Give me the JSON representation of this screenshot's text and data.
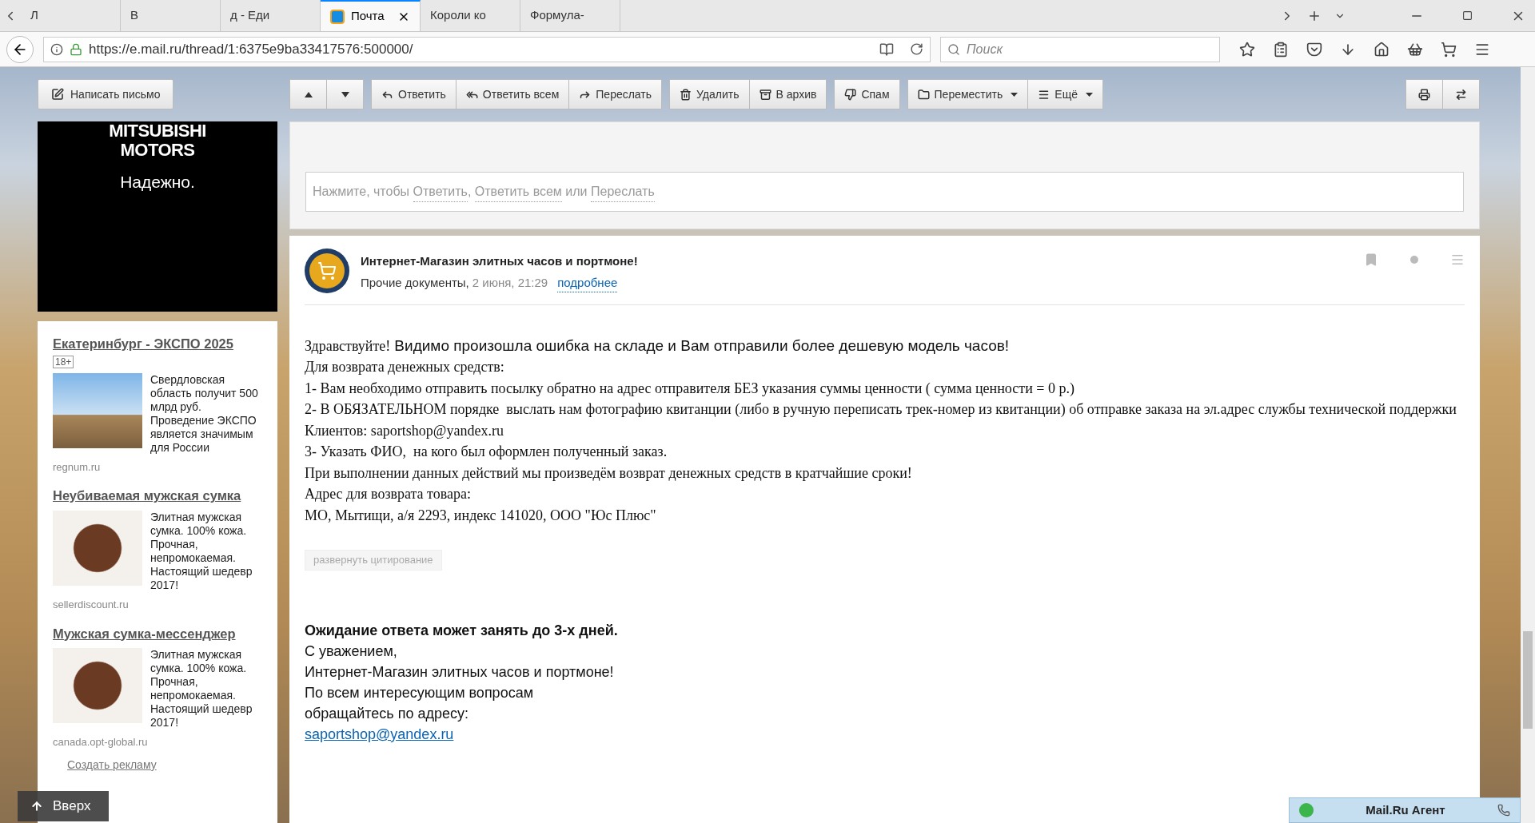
{
  "browser": {
    "tabs": [
      {
        "label": "Л",
        "selected": false
      },
      {
        "label": "В",
        "selected": false
      },
      {
        "label": "д - Еди",
        "selected": false
      },
      {
        "label": "Почта",
        "selected": true
      },
      {
        "label": "Короли ко",
        "selected": false
      },
      {
        "label": "Формула-",
        "selected": false
      }
    ],
    "url": "https://e.mail.ru/thread/1:6375e9ba33417576:500000/",
    "search": {
      "placeholder": "Поиск"
    }
  },
  "toolbar": {
    "compose": "Написать письмо",
    "groups": [
      [
        {
          "kind": "up"
        },
        {
          "kind": "down"
        }
      ],
      [
        {
          "kind": "reply",
          "label": "Ответить"
        },
        {
          "kind": "replyall",
          "label": "Ответить всем"
        },
        {
          "kind": "forward",
          "label": "Переслать"
        }
      ],
      [
        {
          "kind": "trash",
          "label": "Удалить"
        },
        {
          "kind": "archive",
          "label": "В архив"
        }
      ],
      [
        {
          "kind": "spam",
          "label": "Спам"
        }
      ],
      [
        {
          "kind": "folder",
          "label": "Переместить",
          "dropdown": true
        },
        {
          "kind": "lines",
          "label": "Ещё",
          "dropdown": true
        }
      ],
      [
        {
          "kind": "print"
        },
        {
          "kind": "convert"
        }
      ]
    ]
  },
  "banner": {
    "brand": "MITSUBISHI MOTORS",
    "slogan": "Надежно."
  },
  "ads": [
    {
      "title": "Екатеринбург - ЭКСПО 2025",
      "age": "18+",
      "text": "Свердловская область получит 500 млрд руб. Проведение ЭКСПО является значимым для России",
      "source": "regnum.ru"
    },
    {
      "title": "Неубиваемая мужская сумка",
      "text": "Элитная мужская сумка. 100% кожа. Прочная, непромокаемая. Настоящий шедевр 2017!",
      "source": "sellerdiscount.ru"
    },
    {
      "title": "Мужская сумка-мессенджер",
      "text": "Элитная мужская сумка. 100% кожа. Прочная, непромокаемая. Настоящий шедевр 2017!",
      "source": "canada.opt-global.ru"
    }
  ],
  "create_ad": "Создать рекламу",
  "scroll_top": "Вверх",
  "reply_hint": [
    {
      "kind": "text",
      "text": "Нажмите, чтобы "
    },
    {
      "kind": "link",
      "text": "Ответить"
    },
    {
      "kind": "text",
      "text": ", "
    },
    {
      "kind": "link",
      "text": "Ответить всем"
    },
    {
      "kind": "text",
      "text": " или "
    },
    {
      "kind": "link",
      "text": "Переслать"
    }
  ],
  "message": {
    "sender": "Интернет-Магазин элитных часов и портмоне!",
    "folder": "Прочие документы,",
    "date": "2 июня, 21:29",
    "details": "подробнее",
    "greeting": "Здравствуйте!",
    "intro": "Видимо произошла ошибка на складе и Вам отправили более дешевую модель часов!",
    "lines": [
      "Для возврата денежных средств:",
      "1- Вам необходимо отправить посылку обратно на адрес отправителя БЕЗ указания суммы ценности ( сумма ценности = 0 р.)",
      "2- В ОБЯЗАТЕЛЬНОМ порядке  выслать нам фотографию квитанции (либо в ручную переписать трек-номер из квитанции) об отправке заказа на эл.адрес службы технической поддержки Клиентов: saportshop@yandex.ru",
      "3- Указать ФИО,  на кого был оформлен полученный заказ.",
      "При выполнении данных действий мы произведём возврат денежных средств в кратчайшие сроки!",
      "Адрес для возврата товара:",
      "МО, Мытищи, а/я 2293, индекс 141020, ООО \"Юс Плюс\""
    ],
    "expand_quote": "развернуть цитирование",
    "note": "Ожидание ответа может занять до 3-х дней.",
    "signature": [
      "С уважением,",
      "Интернет-Магазин элитных часов и портмоне!",
      "По всем интересующим вопросам",
      "обращайтесь по адресу:"
    ],
    "email": "saportshop@yandex.ru"
  },
  "agent": "Mail.Ru Агент"
}
